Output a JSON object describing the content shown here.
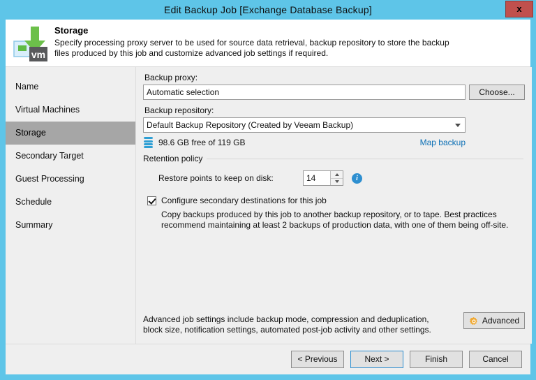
{
  "window": {
    "title": "Edit Backup Job [Exchange Database Backup]",
    "close_label": "x",
    "frame_color": "#5ec5e8"
  },
  "banner": {
    "title": "Storage",
    "description": "Specify processing proxy server to be used for source data retrieval, backup repository to store the backup files produced by this job and customize advanced job settings if required.",
    "icon": "vm-download-icon",
    "icon_label": "vm"
  },
  "sidebar": {
    "items": [
      {
        "label": "Name",
        "selected": false
      },
      {
        "label": "Virtual Machines",
        "selected": false
      },
      {
        "label": "Storage",
        "selected": true
      },
      {
        "label": "Secondary Target",
        "selected": false
      },
      {
        "label": "Guest Processing",
        "selected": false
      },
      {
        "label": "Schedule",
        "selected": false
      },
      {
        "label": "Summary",
        "selected": false
      }
    ]
  },
  "content": {
    "backup_proxy": {
      "label": "Backup proxy:",
      "value": "Automatic selection",
      "choose_label": "Choose..."
    },
    "backup_repository": {
      "label": "Backup repository:",
      "value": "Default Backup Repository (Created by Veeam Backup)",
      "free_space": "98.6 GB free of 119 GB",
      "map_backup_label": "Map backup"
    },
    "retention": {
      "group_label": "Retention policy",
      "restore_points_label": "Restore points to keep on disk:",
      "restore_points_value": "14",
      "info_glyph": "i"
    },
    "secondary": {
      "checkbox_label": "Configure secondary destinations for this job",
      "checked": true,
      "description": "Copy backups produced by this job to another backup repository, or to tape. Best practices recommend maintaining at least 2 backups of production data, with one of them being off-site."
    },
    "advanced": {
      "description": "Advanced job settings include backup mode, compression and deduplication, block size, notification settings, automated post-job activity and other settings.",
      "button_label": "Advanced",
      "accent_color": "#f0a830"
    }
  },
  "buttonbar": {
    "previous_label": "< Previous",
    "next_label": "Next >",
    "finish_label": "Finish",
    "cancel_label": "Cancel"
  }
}
